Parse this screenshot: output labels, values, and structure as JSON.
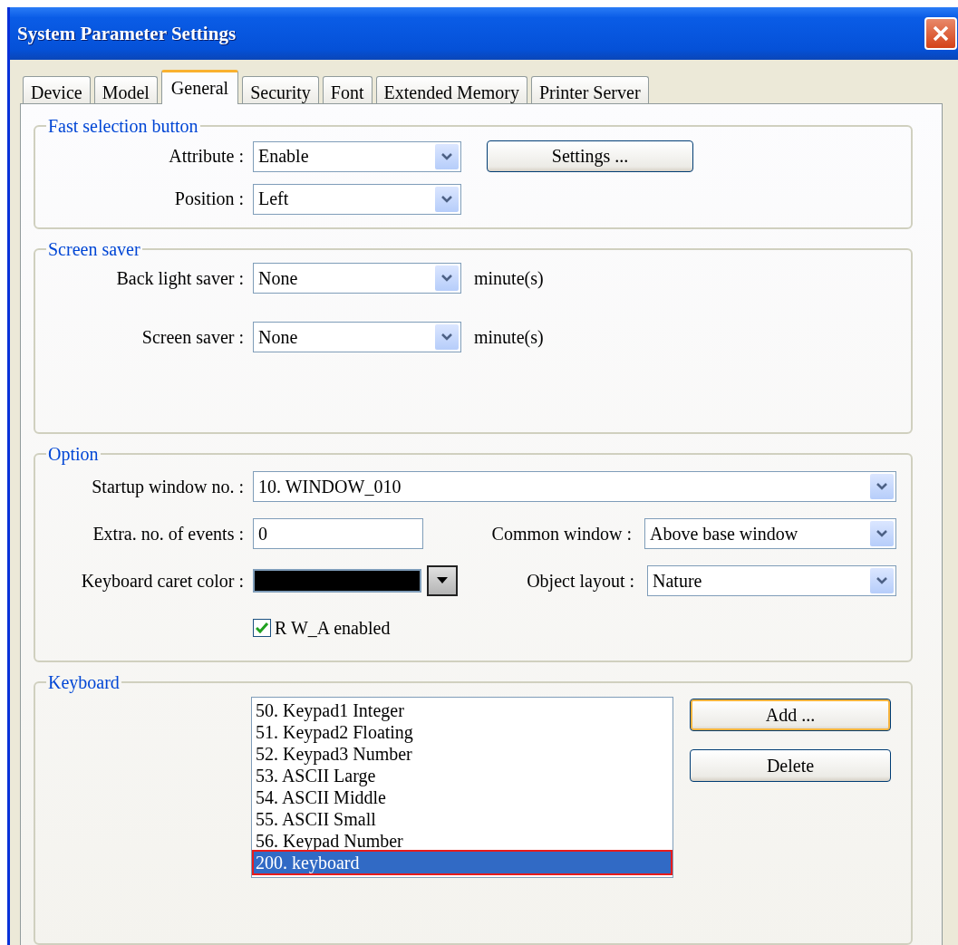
{
  "window": {
    "title": "System Parameter Settings"
  },
  "tabs": [
    {
      "label": "Device",
      "selected": false
    },
    {
      "label": "Model",
      "selected": false
    },
    {
      "label": "General",
      "selected": true
    },
    {
      "label": "Security",
      "selected": false
    },
    {
      "label": "Font",
      "selected": false
    },
    {
      "label": "Extended Memory",
      "selected": false
    },
    {
      "label": "Printer Server",
      "selected": false
    }
  ],
  "fast_selection": {
    "title": "Fast selection button",
    "attribute": {
      "label": "Attribute :",
      "value": "Enable"
    },
    "position": {
      "label": "Position :",
      "value": "Left"
    },
    "settings_button": "Settings ..."
  },
  "screen_saver": {
    "title": "Screen saver",
    "rows": [
      {
        "label": "Back light saver :",
        "value": "None",
        "unit": "minute(s)"
      },
      {
        "label": "Screen saver :",
        "value": "None",
        "unit": "minute(s)"
      }
    ]
  },
  "option": {
    "title": "Option",
    "startup_window": {
      "label": "Startup window no. :",
      "value": "10. WINDOW_010"
    },
    "extra_events": {
      "label": "Extra. no. of events :",
      "value": "0"
    },
    "common_window": {
      "label": "Common window :",
      "value": "Above base window"
    },
    "caret_color": {
      "label": "Keyboard caret color :",
      "color": "#000000"
    },
    "object_layout": {
      "label": "Object layout :",
      "value": "Nature"
    },
    "rw_a": {
      "label": "R W_A enabled",
      "checked": true
    }
  },
  "keyboard": {
    "title": "Keyboard",
    "items": [
      {
        "label": "50. Keypad1 Integer",
        "selected": false
      },
      {
        "label": "51. Keypad2 Floating",
        "selected": false
      },
      {
        "label": "52. Keypad3 Number",
        "selected": false
      },
      {
        "label": "53. ASCII Large",
        "selected": false
      },
      {
        "label": "54. ASCII Middle",
        "selected": false
      },
      {
        "label": "55. ASCII Small",
        "selected": false
      },
      {
        "label": "56. Keypad Number",
        "selected": false
      },
      {
        "label": "200. keyboard",
        "selected": true
      }
    ],
    "buttons": [
      {
        "label": "Add ...",
        "focused": true
      },
      {
        "label": "Delete",
        "focused": false
      }
    ]
  }
}
